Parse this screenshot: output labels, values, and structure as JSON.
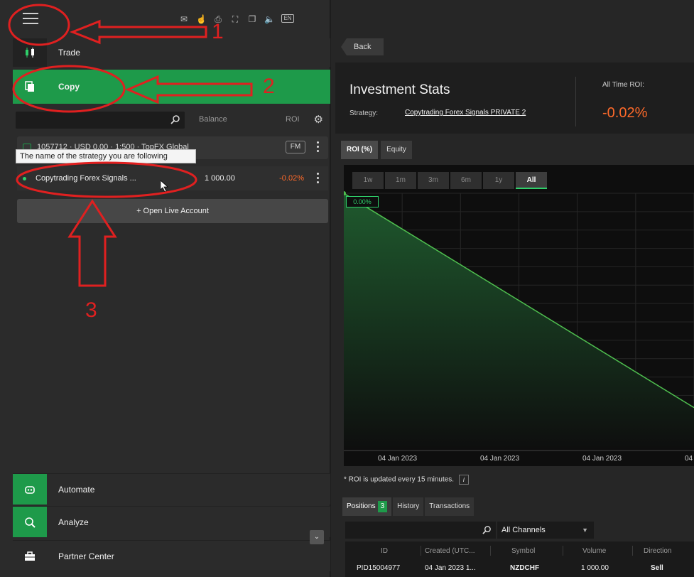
{
  "toolbar": {
    "icons": [
      "envelope-icon",
      "hand-pointer-icon",
      "printer-icon",
      "fullscreen-icon",
      "copy-window-icon",
      "sound-icon",
      "language-icon"
    ],
    "language": "EN"
  },
  "sidebar": {
    "trade_label": "Trade",
    "copy_label": "Copy",
    "search_placeholder": "",
    "col_balance": "Balance",
    "col_roi": "ROI",
    "account_text": "1057712 · USD 0.00 · 1:500 · TopFX Global",
    "account_badge": "FM",
    "tooltip": "The name of the strategy you are following",
    "strategy": {
      "name": "Copytrading Forex Signals ...",
      "balance": "1 000.00",
      "roi": "-0.02%"
    },
    "open_live": "+ Open Live Account",
    "bottom": [
      {
        "label": "Automate",
        "icon": "robot-icon"
      },
      {
        "label": "Analyze",
        "icon": "magnifier-chart-icon"
      },
      {
        "label": "Partner Center",
        "icon": "briefcase-icon"
      }
    ]
  },
  "annotations": [
    "1",
    "2",
    "3"
  ],
  "main": {
    "back_label": "Back",
    "title": "Investment Stats",
    "strategy_label": "Strategy:",
    "strategy_value": "Copytrading Forex Signals PRIVATE 2",
    "roi_label": "All Time ROI:",
    "roi_value": "-0.02%",
    "chart_tabs": [
      "ROI (%)",
      "Equity"
    ],
    "ranges": [
      "1w",
      "1m",
      "3m",
      "6m",
      "1y",
      "All"
    ],
    "roi_tag": "0.00%",
    "x_ticks": [
      "04 Jan 2023",
      "04 Jan 2023",
      "04 Jan 2023",
      "04"
    ],
    "roi_note": "* ROI is updated every 15 minutes.",
    "info_glyph": "i",
    "pos_tabs": {
      "positions": "Positions",
      "positions_count": "3",
      "history": "History",
      "transactions": "Transactions"
    },
    "channel": "All Channels",
    "columns": [
      "ID",
      "Created (UTC...",
      "Symbol",
      "Volume",
      "Direction"
    ],
    "row": [
      "PID15004977",
      "04 Jan 2023 1...",
      "NZDCHF",
      "1 000.00",
      "Sell"
    ]
  },
  "colors": {
    "accent": "#1e9a4a",
    "negative": "#ff6a2a",
    "line": "#4fbf4f",
    "annotation": "#e02020"
  },
  "chart_data": {
    "type": "area",
    "x": [
      "04 Jan 2023",
      "04 Jan 2023",
      "04 Jan 2023"
    ],
    "series": [
      {
        "values": [
          0.0,
          -0.01,
          -0.02
        ]
      }
    ],
    "ylabel": "",
    "grid": true
  }
}
